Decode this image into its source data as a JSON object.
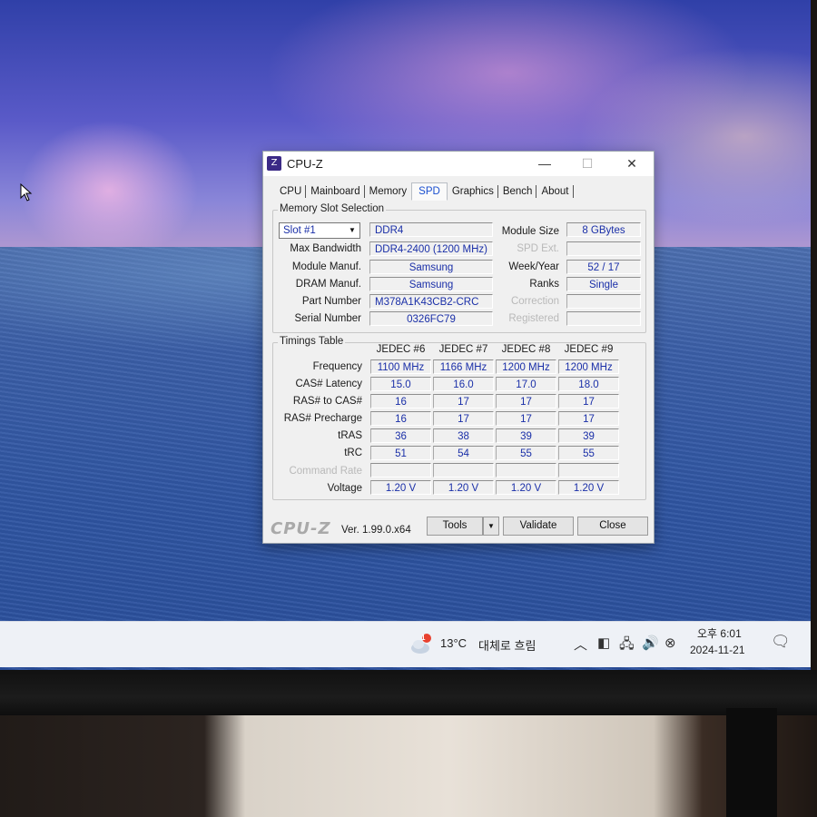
{
  "window": {
    "title": "CPU-Z",
    "icon_label": "Z",
    "controls": [
      "—",
      "☐",
      "✕"
    ]
  },
  "tabs": [
    {
      "label": "CPU",
      "active": false
    },
    {
      "label": "Mainboard",
      "active": false
    },
    {
      "label": "Memory",
      "active": false
    },
    {
      "label": "SPD",
      "active": true
    },
    {
      "label": "Graphics",
      "active": false
    },
    {
      "label": "Bench",
      "active": false
    },
    {
      "label": "About",
      "active": false
    }
  ],
  "slot_section": {
    "title": "Memory Slot Selection",
    "slot_value": "Slot #1",
    "type_value": "DDR4",
    "max_bandwidth_label": "Max Bandwidth",
    "max_bandwidth_value": "DDR4-2400 (1200 MHz)",
    "module_manuf_label": "Module Manuf.",
    "module_manuf_value": "Samsung",
    "dram_manuf_label": "DRAM Manuf.",
    "dram_manuf_value": "Samsung",
    "part_number_label": "Part Number",
    "part_number_value": "M378A1K43CB2-CRC",
    "serial_number_label": "Serial Number",
    "serial_number_value": "0326FC79",
    "module_size_label": "Module Size",
    "module_size_value": "8 GBytes",
    "spd_ext_label": "SPD Ext.",
    "spd_ext_value": "",
    "week_year_label": "Week/Year",
    "week_year_value": "52 / 17",
    "ranks_label": "Ranks",
    "ranks_value": "Single",
    "correction_label": "Correction",
    "correction_value": "",
    "registered_label": "Registered",
    "registered_value": ""
  },
  "timings": {
    "title": "Timings Table",
    "columns": [
      "JEDEC #6",
      "JEDEC #7",
      "JEDEC #8",
      "JEDEC #9"
    ],
    "rows": [
      {
        "label": "Frequency",
        "values": [
          "1100 MHz",
          "1166 MHz",
          "1200 MHz",
          "1200 MHz"
        ]
      },
      {
        "label": "CAS# Latency",
        "values": [
          "15.0",
          "16.0",
          "17.0",
          "18.0"
        ]
      },
      {
        "label": "RAS# to CAS#",
        "values": [
          "16",
          "17",
          "17",
          "17"
        ]
      },
      {
        "label": "RAS# Precharge",
        "values": [
          "16",
          "17",
          "17",
          "17"
        ]
      },
      {
        "label": "tRAS",
        "values": [
          "36",
          "38",
          "39",
          "39"
        ]
      },
      {
        "label": "tRC",
        "values": [
          "51",
          "54",
          "55",
          "55"
        ]
      },
      {
        "label": "Command Rate",
        "values": [
          "",
          "",
          "",
          ""
        ]
      },
      {
        "label": "Voltage",
        "values": [
          "1.20 V",
          "1.20 V",
          "1.20 V",
          "1.20 V"
        ]
      }
    ]
  },
  "footer": {
    "logo": "CPU-Z",
    "version": "Ver. 1.99.0.x64",
    "tools_label": "Tools",
    "validate_label": "Validate",
    "close_label": "Close"
  },
  "taskbar": {
    "weather_temp": "13°C",
    "weather_desc": "대체로 흐림",
    "time": "오후 6:01",
    "date": "2024-11-21",
    "weather_badge": "1"
  }
}
